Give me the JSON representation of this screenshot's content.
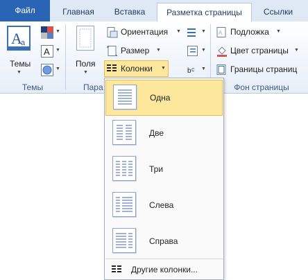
{
  "tabs": [
    {
      "label": "Файл"
    },
    {
      "label": "Главная"
    },
    {
      "label": "Вставка"
    },
    {
      "label": "Разметка страницы"
    },
    {
      "label": "Ссылки"
    }
  ],
  "ribbon": {
    "themes_button": "Темы",
    "fields_button": "Поля",
    "orientation": "Ориентация",
    "size": "Размер",
    "columns": "Колонки",
    "watermark": "Подложка",
    "page_color": "Цвет страницы",
    "page_borders": "Границы страниц",
    "group_themes": "Темы",
    "group_page_setup": "Пара",
    "group_background": "Фон страницы"
  },
  "columns_menu": {
    "items": [
      {
        "label": "Одна",
        "icon": "columns-one-icon"
      },
      {
        "label": "Две",
        "icon": "columns-two-icon"
      },
      {
        "label": "Три",
        "icon": "columns-three-icon"
      },
      {
        "label": "Слева",
        "icon": "columns-left-icon"
      },
      {
        "label": "Справа",
        "icon": "columns-right-icon"
      }
    ],
    "more": "Другие колонки..."
  },
  "colors": {
    "file_tab": "#2a64b5",
    "hover": "#fde79c",
    "accent_text": "#1e395b"
  }
}
